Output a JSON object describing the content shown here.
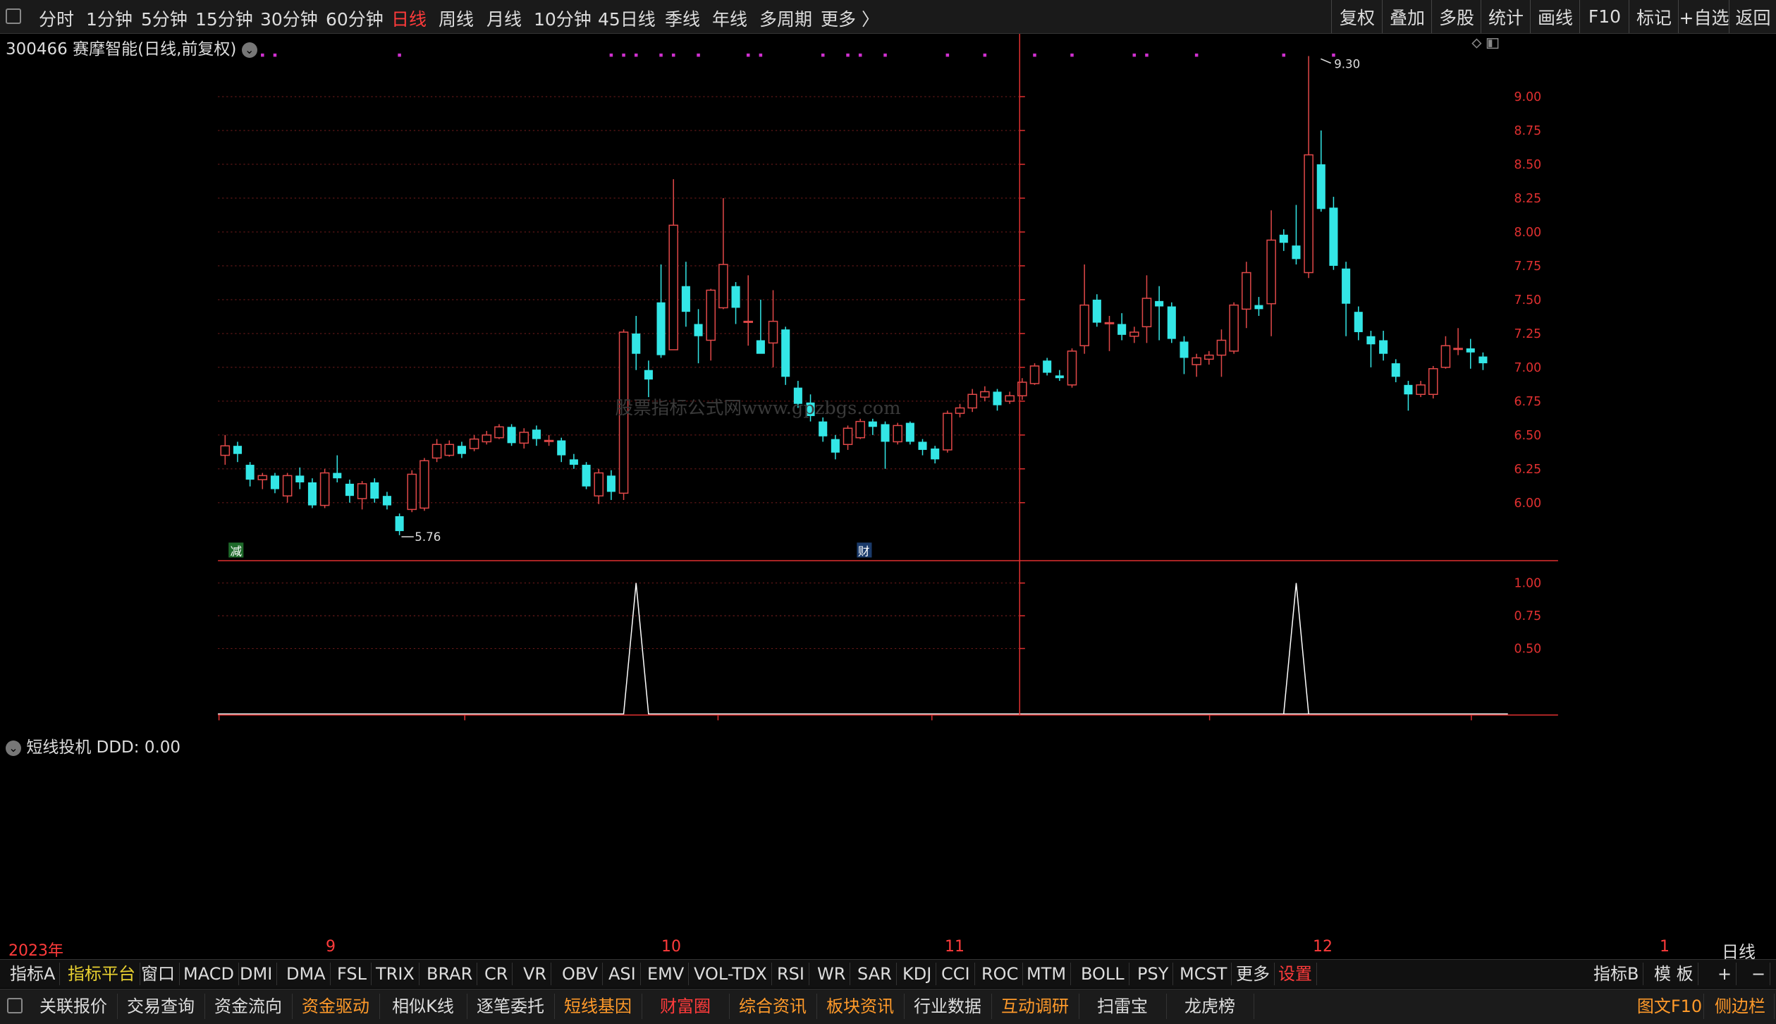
{
  "topbar": {
    "periods": [
      "分时",
      "1分钟",
      "5分钟",
      "15分钟",
      "30分钟",
      "60分钟",
      "日线",
      "周线",
      "月线",
      "10分钟",
      "45日线",
      "季线",
      "年线",
      "多周期",
      "更多 〉"
    ],
    "active_period": "日线",
    "right_buttons": [
      "复权",
      "叠加",
      "多股",
      "统计",
      "画线",
      "F10",
      "标记",
      "+自选",
      "返回"
    ]
  },
  "stock": {
    "code": "300466",
    "name": "赛摩智能",
    "mode": "(日线,前复权)"
  },
  "annotations": {
    "high": "9.30",
    "low": "5.76",
    "watermark": "股票指标公式网www.gpzbgs.com",
    "badge_jian": "减",
    "badge_cai": "财"
  },
  "indicator": {
    "name": "短线投机",
    "readout": "DDD: 0.00"
  },
  "bottom_axis": {
    "labels": [
      "2023年",
      "9",
      "10",
      "11",
      "12",
      "1"
    ],
    "period_box": "日线"
  },
  "colors": {
    "up": "#e04848",
    "down": "#33e6e6",
    "axis": "#e03030",
    "grid": "#6a1a1a",
    "line": "#ffffff",
    "dots": "#d030d0"
  },
  "chart_data": {
    "type": "candlestick",
    "y_ticks": [
      "9.00",
      "8.75",
      "8.50",
      "8.25",
      "8.00",
      "7.75",
      "7.50",
      "7.25",
      "7.00",
      "6.75",
      "6.50",
      "6.25",
      "6.00"
    ],
    "ind_ticks": [
      "1.00",
      "0.75",
      "0.50"
    ],
    "candles": [
      {
        "o": 6.35,
        "c": 6.42,
        "h": 6.5,
        "l": 6.28
      },
      {
        "o": 6.42,
        "c": 6.36,
        "h": 6.45,
        "l": 6.3
      },
      {
        "o": 6.28,
        "c": 6.17,
        "h": 6.3,
        "l": 6.12
      },
      {
        "o": 6.17,
        "c": 6.2,
        "h": 6.22,
        "l": 6.1
      },
      {
        "o": 6.2,
        "c": 6.1,
        "h": 6.22,
        "l": 6.07
      },
      {
        "o": 6.05,
        "c": 6.2,
        "h": 6.22,
        "l": 6.0
      },
      {
        "o": 6.2,
        "c": 6.15,
        "h": 6.26,
        "l": 6.1
      },
      {
        "o": 6.15,
        "c": 5.98,
        "h": 6.18,
        "l": 5.96
      },
      {
        "o": 5.98,
        "c": 6.22,
        "h": 6.25,
        "l": 5.96
      },
      {
        "o": 6.22,
        "c": 6.18,
        "h": 6.35,
        "l": 6.15
      },
      {
        "o": 6.14,
        "c": 6.05,
        "h": 6.17,
        "l": 6.0
      },
      {
        "o": 6.03,
        "c": 6.14,
        "h": 6.16,
        "l": 5.95
      },
      {
        "o": 6.15,
        "c": 6.03,
        "h": 6.18,
        "l": 6.0
      },
      {
        "o": 6.05,
        "c": 5.98,
        "h": 6.08,
        "l": 5.95
      },
      {
        "o": 5.9,
        "c": 5.79,
        "h": 5.92,
        "l": 5.76
      },
      {
        "o": 5.95,
        "c": 6.21,
        "h": 6.24,
        "l": 5.93
      },
      {
        "o": 5.96,
        "c": 6.31,
        "h": 6.33,
        "l": 5.94
      },
      {
        "o": 6.33,
        "c": 6.43,
        "h": 6.47,
        "l": 6.3
      },
      {
        "o": 6.35,
        "c": 6.43,
        "h": 6.46,
        "l": 6.34
      },
      {
        "o": 6.42,
        "c": 6.36,
        "h": 6.45,
        "l": 6.33
      },
      {
        "o": 6.4,
        "c": 6.47,
        "h": 6.5,
        "l": 6.38
      },
      {
        "o": 6.45,
        "c": 6.5,
        "h": 6.53,
        "l": 6.43
      },
      {
        "o": 6.48,
        "c": 6.56,
        "h": 6.58,
        "l": 6.47
      },
      {
        "o": 6.56,
        "c": 6.44,
        "h": 6.58,
        "l": 6.42
      },
      {
        "o": 6.44,
        "c": 6.52,
        "h": 6.55,
        "l": 6.4
      },
      {
        "o": 6.54,
        "c": 6.47,
        "h": 6.57,
        "l": 6.42
      },
      {
        "o": 6.46,
        "c": 6.46,
        "h": 6.5,
        "l": 6.42
      },
      {
        "o": 6.46,
        "c": 6.35,
        "h": 6.48,
        "l": 6.3
      },
      {
        "o": 6.32,
        "c": 6.28,
        "h": 6.36,
        "l": 6.25
      },
      {
        "o": 6.28,
        "c": 6.12,
        "h": 6.3,
        "l": 6.1
      },
      {
        "o": 6.05,
        "c": 6.22,
        "h": 6.25,
        "l": 5.99
      },
      {
        "o": 6.2,
        "c": 6.08,
        "h": 6.24,
        "l": 6.02
      },
      {
        "o": 6.07,
        "c": 7.26,
        "h": 7.28,
        "l": 6.02
      },
      {
        "o": 7.25,
        "c": 7.1,
        "h": 7.38,
        "l": 6.98
      },
      {
        "o": 6.98,
        "c": 6.91,
        "h": 7.05,
        "l": 6.78
      },
      {
        "o": 7.48,
        "c": 7.09,
        "h": 7.76,
        "l": 7.07
      },
      {
        "o": 7.13,
        "c": 8.05,
        "h": 8.39,
        "l": 7.13
      },
      {
        "o": 7.6,
        "c": 7.41,
        "h": 7.78,
        "l": 7.3
      },
      {
        "o": 7.32,
        "c": 7.23,
        "h": 7.43,
        "l": 7.03
      },
      {
        "o": 7.2,
        "c": 7.57,
        "h": 7.58,
        "l": 7.05
      },
      {
        "o": 7.44,
        "c": 7.76,
        "h": 8.25,
        "l": 7.43
      },
      {
        "o": 7.6,
        "c": 7.44,
        "h": 7.63,
        "l": 7.32
      },
      {
        "o": 7.34,
        "c": 7.34,
        "h": 7.68,
        "l": 7.16
      },
      {
        "o": 7.2,
        "c": 7.1,
        "h": 7.5,
        "l": 7.16
      },
      {
        "o": 7.18,
        "c": 7.34,
        "h": 7.57,
        "l": 7.0
      },
      {
        "o": 7.28,
        "c": 6.93,
        "h": 7.3,
        "l": 6.87
      },
      {
        "o": 6.85,
        "c": 6.73,
        "h": 6.9,
        "l": 6.7
      },
      {
        "o": 6.74,
        "c": 6.64,
        "h": 6.8,
        "l": 6.6
      },
      {
        "o": 6.6,
        "c": 6.49,
        "h": 6.63,
        "l": 6.45
      },
      {
        "o": 6.47,
        "c": 6.37,
        "h": 6.5,
        "l": 6.32
      },
      {
        "o": 6.43,
        "c": 6.55,
        "h": 6.57,
        "l": 6.39
      },
      {
        "o": 6.48,
        "c": 6.6,
        "h": 6.62,
        "l": 6.47
      },
      {
        "o": 6.6,
        "c": 6.56,
        "h": 6.62,
        "l": 6.5
      },
      {
        "o": 6.58,
        "c": 6.45,
        "h": 6.6,
        "l": 6.25
      },
      {
        "o": 6.45,
        "c": 6.57,
        "h": 6.59,
        "l": 6.43
      },
      {
        "o": 6.59,
        "c": 6.45,
        "h": 6.6,
        "l": 6.43
      },
      {
        "o": 6.45,
        "c": 6.39,
        "h": 6.47,
        "l": 6.35
      },
      {
        "o": 6.4,
        "c": 6.32,
        "h": 6.42,
        "l": 6.29
      },
      {
        "o": 6.39,
        "c": 6.66,
        "h": 6.68,
        "l": 6.37
      },
      {
        "o": 6.66,
        "c": 6.7,
        "h": 6.73,
        "l": 6.63
      },
      {
        "o": 6.7,
        "c": 6.8,
        "h": 6.84,
        "l": 6.67
      },
      {
        "o": 6.78,
        "c": 6.82,
        "h": 6.86,
        "l": 6.75
      },
      {
        "o": 6.82,
        "c": 6.72,
        "h": 6.84,
        "l": 6.68
      },
      {
        "o": 6.75,
        "c": 6.79,
        "h": 6.82,
        "l": 6.73
      },
      {
        "o": 6.79,
        "c": 6.89,
        "h": 6.92,
        "l": 6.76
      },
      {
        "o": 6.88,
        "c": 7.01,
        "h": 7.03,
        "l": 6.87
      },
      {
        "o": 7.05,
        "c": 6.96,
        "h": 7.07,
        "l": 6.94
      },
      {
        "o": 6.94,
        "c": 6.92,
        "h": 6.98,
        "l": 6.9
      },
      {
        "o": 6.87,
        "c": 7.12,
        "h": 7.14,
        "l": 6.85
      },
      {
        "o": 7.16,
        "c": 7.46,
        "h": 7.76,
        "l": 7.1
      },
      {
        "o": 7.5,
        "c": 7.33,
        "h": 7.54,
        "l": 7.3
      },
      {
        "o": 7.33,
        "c": 7.33,
        "h": 7.38,
        "l": 7.12
      },
      {
        "o": 7.32,
        "c": 7.24,
        "h": 7.4,
        "l": 7.2
      },
      {
        "o": 7.23,
        "c": 7.26,
        "h": 7.3,
        "l": 7.18
      },
      {
        "o": 7.3,
        "c": 7.51,
        "h": 7.68,
        "l": 7.18
      },
      {
        "o": 7.49,
        "c": 7.45,
        "h": 7.6,
        "l": 7.2
      },
      {
        "o": 7.45,
        "c": 7.21,
        "h": 7.48,
        "l": 7.18
      },
      {
        "o": 7.19,
        "c": 7.07,
        "h": 7.23,
        "l": 6.95
      },
      {
        "o": 7.02,
        "c": 7.07,
        "h": 7.1,
        "l": 6.93
      },
      {
        "o": 7.06,
        "c": 7.09,
        "h": 7.12,
        "l": 7.02
      },
      {
        "o": 7.09,
        "c": 7.2,
        "h": 7.28,
        "l": 6.93
      },
      {
        "o": 7.12,
        "c": 7.46,
        "h": 7.48,
        "l": 7.1
      },
      {
        "o": 7.43,
        "c": 7.7,
        "h": 7.78,
        "l": 7.29
      },
      {
        "o": 7.46,
        "c": 7.43,
        "h": 7.52,
        "l": 7.38
      },
      {
        "o": 7.47,
        "c": 7.94,
        "h": 8.16,
        "l": 7.23
      },
      {
        "o": 7.98,
        "c": 7.92,
        "h": 8.02,
        "l": 7.86
      },
      {
        "o": 7.9,
        "c": 7.8,
        "h": 8.2,
        "l": 7.76
      },
      {
        "o": 7.7,
        "c": 8.57,
        "h": 9.3,
        "l": 7.66
      },
      {
        "o": 8.5,
        "c": 8.17,
        "h": 8.75,
        "l": 8.15
      },
      {
        "o": 8.18,
        "c": 7.75,
        "h": 8.26,
        "l": 7.72
      },
      {
        "o": 7.73,
        "c": 7.47,
        "h": 7.78,
        "l": 7.23
      },
      {
        "o": 7.41,
        "c": 7.26,
        "h": 7.45,
        "l": 7.2
      },
      {
        "o": 7.23,
        "c": 7.17,
        "h": 7.27,
        "l": 7.0
      },
      {
        "o": 7.2,
        "c": 7.1,
        "h": 7.27,
        "l": 7.05
      },
      {
        "o": 7.03,
        "c": 6.93,
        "h": 7.06,
        "l": 6.89
      },
      {
        "o": 6.87,
        "c": 6.8,
        "h": 6.9,
        "l": 6.68
      },
      {
        "o": 6.8,
        "c": 6.87,
        "h": 6.9,
        "l": 6.78
      },
      {
        "o": 6.8,
        "c": 6.99,
        "h": 7.01,
        "l": 6.77
      },
      {
        "o": 7.0,
        "c": 7.16,
        "h": 7.23,
        "l": 6.99
      },
      {
        "o": 7.14,
        "c": 7.14,
        "h": 7.29,
        "l": 7.09
      },
      {
        "o": 7.14,
        "c": 7.11,
        "h": 7.21,
        "l": 6.99
      },
      {
        "o": 7.08,
        "c": 7.03,
        "h": 7.11,
        "l": 6.98
      }
    ],
    "signal": [
      0,
      0,
      0,
      0,
      0,
      0,
      0,
      0,
      0,
      0,
      0,
      0,
      0,
      0,
      0,
      0,
      0,
      0,
      0,
      0,
      0,
      0,
      0,
      0,
      0,
      0,
      0,
      0,
      0,
      0,
      0,
      0,
      0,
      1,
      0,
      0,
      0,
      0,
      0,
      0,
      0,
      0,
      0,
      0,
      0,
      0,
      0,
      0,
      0,
      0,
      0,
      0,
      0,
      0,
      0,
      0,
      0,
      0,
      0,
      0,
      0,
      0,
      0,
      0,
      0,
      0,
      0,
      0,
      0,
      0,
      0,
      0,
      0,
      0,
      0,
      0,
      0,
      0,
      0,
      0,
      0,
      0,
      0,
      0,
      0,
      0,
      1,
      0,
      0,
      0,
      0,
      0,
      0,
      0,
      0,
      0,
      0,
      0,
      0,
      0,
      0,
      0,
      0,
      0
    ],
    "dots": [
      3,
      4,
      14,
      31,
      32,
      33,
      35,
      36,
      38,
      42,
      43,
      48,
      50,
      51,
      53,
      58,
      61,
      65,
      68,
      73,
      74,
      78,
      85,
      89
    ]
  },
  "tabs1": [
    "指标A",
    "指标平台",
    "窗口",
    "MACD",
    "DMI",
    "DMA",
    "FSL",
    "TRIX",
    "BRAR",
    "CR",
    "VR",
    "OBV",
    "ASI",
    "EMV",
    "VOL-TDX",
    "RSI",
    "WR",
    "SAR",
    "KDJ",
    "CCI",
    "ROC",
    "MTM",
    "BOLL",
    "PSY",
    "MCST",
    "更多",
    "设置"
  ],
  "tabs1_right": [
    "指标B",
    "模 板",
    "+",
    "−"
  ],
  "tabs2": [
    "关联报价",
    "交易查询",
    "资金流向",
    "资金驱动",
    "相似K线",
    "逐笔委托",
    "短线基因",
    "财富圈",
    "综合资讯",
    "板块资讯",
    "行业数据",
    "互动调研",
    "扫雷宝",
    "龙虎榜"
  ],
  "tabs2_right": [
    "图文F10",
    "侧边栏"
  ]
}
